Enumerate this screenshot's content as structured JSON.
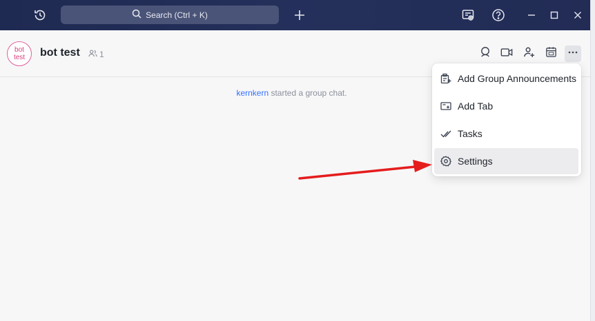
{
  "titlebar": {
    "search_label": "Search (Ctrl + K)"
  },
  "chat": {
    "avatar_line1": "bot",
    "avatar_line2": "test",
    "title": "bot test",
    "member_count": "1"
  },
  "system_message": {
    "user": "kernkern",
    "text": "started a group chat."
  },
  "menu": {
    "items": [
      {
        "label": "Add Group Announcements",
        "icon": "announcement-icon"
      },
      {
        "label": "Add Tab",
        "icon": "add-tab-icon"
      },
      {
        "label": "Tasks",
        "icon": "tasks-icon"
      },
      {
        "label": "Settings",
        "icon": "settings-icon",
        "highlighted": true
      }
    ]
  },
  "colors": {
    "titlebar": "#222c55",
    "accent_link": "#3370ff",
    "avatar_pink": "#e0609a",
    "annotation_arrow": "#e51d1d"
  }
}
